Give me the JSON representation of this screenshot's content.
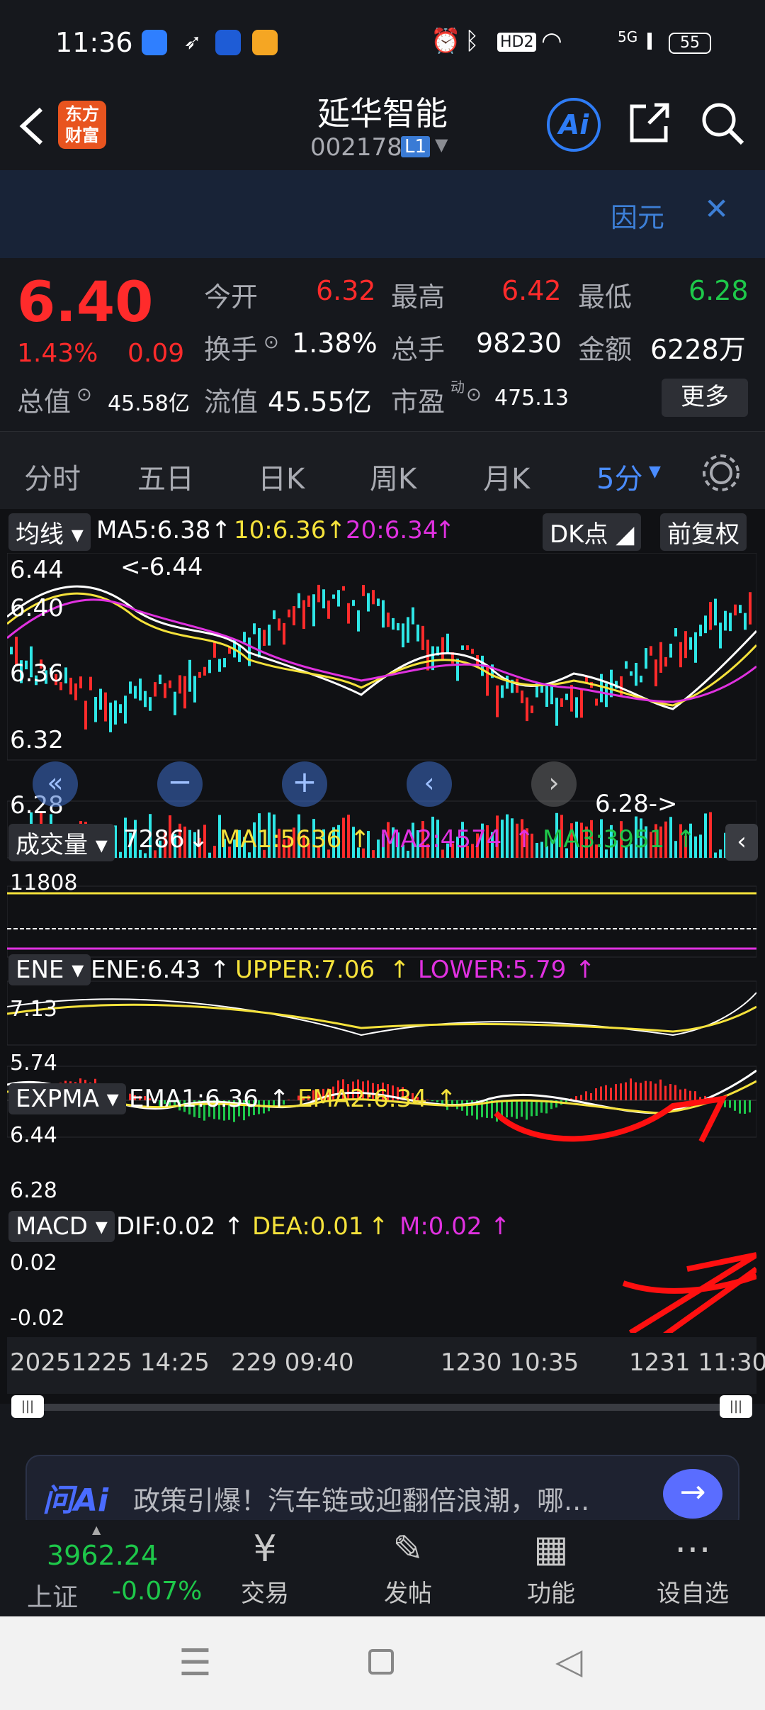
{
  "status_bar": {
    "time": "11:36",
    "hd_badge": "HD2",
    "network": "5G",
    "battery": "55"
  },
  "header": {
    "logo_text": "东方财富",
    "stock_name": "延华智能",
    "stock_code": "002178",
    "level_badge": "L1"
  },
  "banner": {
    "text": "因元"
  },
  "quote": {
    "price": "6.40",
    "change_pct": "1.43%",
    "change": "0.09",
    "open_label": "今开",
    "open": "6.32",
    "high_label": "最高",
    "high": "6.42",
    "low_label": "最低",
    "low": "6.28",
    "turnover_label": "换手",
    "turnover": "1.38%",
    "volume_label": "总手",
    "volume": "98230",
    "amount_label": "金额",
    "amount": "6228万",
    "mcap_label": "总值",
    "mcap": "45.58亿",
    "float_label": "流值",
    "float_cap": "45.55亿",
    "pe_label": "市盈",
    "pe_sup": "动",
    "pe": "475.13",
    "more_label": "更多"
  },
  "tabs": [
    "分时",
    "五日",
    "日K",
    "周K",
    "月K",
    "5分"
  ],
  "indicators": {
    "ma": {
      "selector": "均线",
      "ma5": "MA5:6.38",
      "ma10": "10:6.36",
      "ma20": "20:6.34",
      "dk_label": "DK点",
      "fq_label": "前复权",
      "y_ticks": [
        "6.44",
        "6.40",
        "6.36",
        "6.32",
        "6.28"
      ],
      "high_mark": "<-6.44",
      "low_mark": "6.28->"
    },
    "vol": {
      "selector": "成交量",
      "value": "7286",
      "ma1": "MA1:5636",
      "ma2": "MA2:4574",
      "ma3": "MA3:3951",
      "y_tick": "11808"
    },
    "ene": {
      "selector": "ENE",
      "ene": "ENE:6.43",
      "upper": "UPPER:7.06",
      "lower": "LOWER:5.79",
      "y_top": "7.13",
      "y_bottom": "5.74"
    },
    "expma": {
      "selector": "EXPMA",
      "ema1": "EMA1:6.36",
      "ema2": "EMA2:6.34",
      "y_top": "6.44",
      "y_bottom": "6.28"
    },
    "macd": {
      "selector": "MACD",
      "dif": "DIF:0.02",
      "dea": "DEA:0.01",
      "m": "M:0.02",
      "y_top": "0.02",
      "y_bottom": "-0.02"
    }
  },
  "time_axis": [
    "20251225 14:25",
    "229 09:40",
    "1230 10:35",
    "1231 11:30"
  ],
  "ai_bar": {
    "brand": "问Ai",
    "text": "政策引爆！汽车链或迎翻倍浪潮，哪..."
  },
  "bottom": {
    "index_value": "3962.24",
    "index_name": "上证",
    "index_change": "-0.07%",
    "nav": [
      "交易",
      "发帖",
      "功能",
      "设自选"
    ]
  },
  "colors": {
    "up": "#ff2b2b",
    "down": "#1ec84a",
    "accent": "#4a8cff",
    "bg": "#16181d"
  }
}
